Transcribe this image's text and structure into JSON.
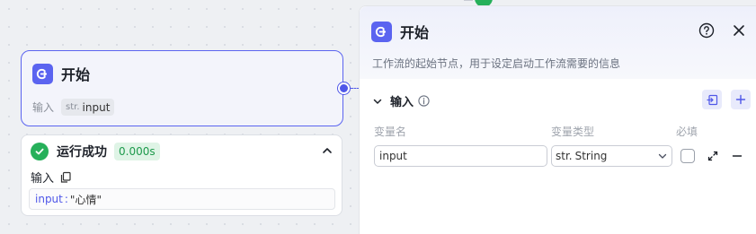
{
  "node": {
    "title": "开始",
    "io_label": "输入",
    "chip_type": "str.",
    "chip_value": "input"
  },
  "run": {
    "title": "运行成功",
    "duration": "0.000s",
    "io_label": "输入",
    "key": "input",
    "separator": ":",
    "value": "\"心情\""
  },
  "panel": {
    "title": "开始",
    "description": "工作流的起始节点，用于设定启动工作流需要的信息",
    "section_title": "输入",
    "columns": {
      "name": "变量名",
      "type": "变量类型",
      "required": "必填"
    },
    "row": {
      "name_value": "input",
      "type_prefix": "str.",
      "type_value": "String",
      "required": false
    }
  },
  "colors": {
    "accent": "#5b64f0",
    "success": "#26b05a"
  },
  "icons": {
    "node": "start-icon",
    "success": "check-circle-icon",
    "copy": "copy-icon",
    "help": "help-icon",
    "close": "close-icon",
    "collapse": "chevron-up-icon",
    "section": "chevron-down-icon",
    "info": "info-icon",
    "import": "import-icon",
    "add": "plus-icon",
    "expand": "expand-icon",
    "remove": "minus-icon"
  }
}
